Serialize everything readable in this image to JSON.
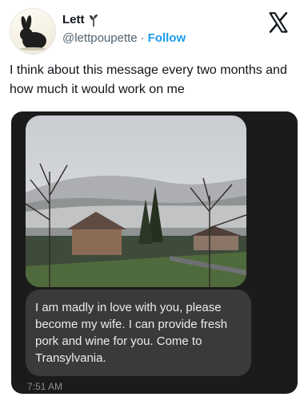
{
  "header": {
    "display_name": "Lett",
    "handle": "@lettpoupette",
    "separator": "·",
    "follow_label": "Follow"
  },
  "icons": {
    "avatar": "bunny-avatar",
    "name_glyph": "plant-sprout-icon",
    "platform": "x-logo-icon"
  },
  "tweet": {
    "text": "I think about this message every two months and how much it would work on me"
  },
  "screenshot": {
    "message": "I am madly in love with you, please become my wife. I can provide fresh pork and wine for you. Come to Transylvania.",
    "time": "7:51 AM"
  },
  "colors": {
    "accent": "#1d9bf0",
    "text": "#0f1419",
    "secondary": "#536471",
    "bubble": "#3a3a3c"
  }
}
